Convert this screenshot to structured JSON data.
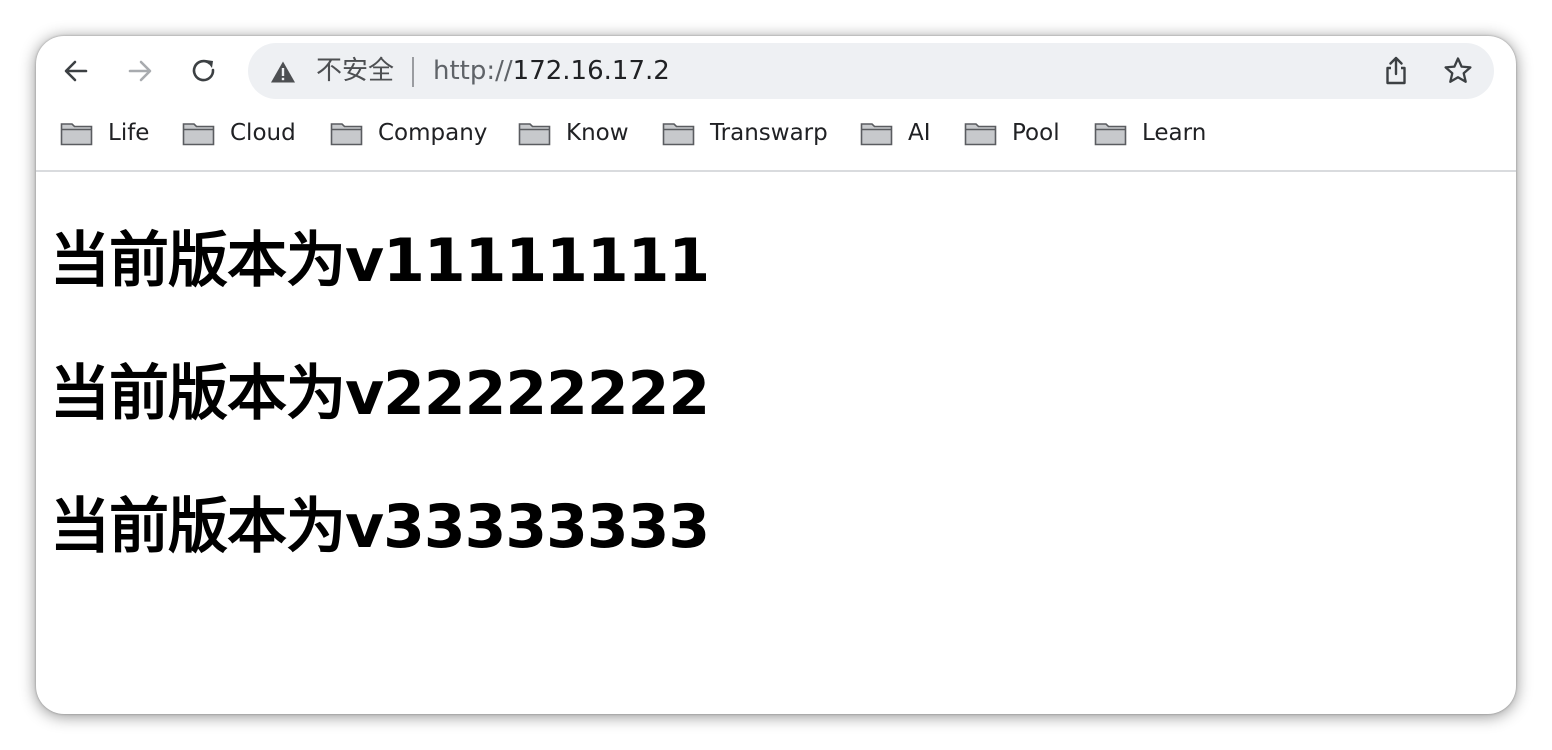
{
  "toolbar": {
    "back_icon": "arrow-left-icon",
    "forward_icon": "arrow-right-icon",
    "reload_icon": "reload-icon",
    "share_icon": "share-icon",
    "bookmark_icon": "star-icon"
  },
  "omnibox": {
    "security_icon": "warning-triangle-icon",
    "security_label": "不安全",
    "url_scheme": "http://",
    "url_host": "172.16.17.2"
  },
  "bookmarks": [
    {
      "label": "Life",
      "icon": "folder-icon"
    },
    {
      "label": "Cloud",
      "icon": "folder-icon"
    },
    {
      "label": "Company",
      "icon": "folder-icon"
    },
    {
      "label": "Know",
      "icon": "folder-icon"
    },
    {
      "label": "Transwarp",
      "icon": "folder-icon"
    },
    {
      "label": "AI",
      "icon": "folder-icon"
    },
    {
      "label": "Pool",
      "icon": "folder-icon"
    },
    {
      "label": "Learn",
      "icon": "folder-icon"
    }
  ],
  "page": {
    "headings": [
      "当前版本为v11111111",
      "当前版本为v22222222",
      "当前版本为v33333333"
    ]
  },
  "colors": {
    "omnibox_bg": "#eef0f3",
    "text": "#202124",
    "muted": "#5f6368",
    "forward_disabled": "#a8abaf"
  }
}
